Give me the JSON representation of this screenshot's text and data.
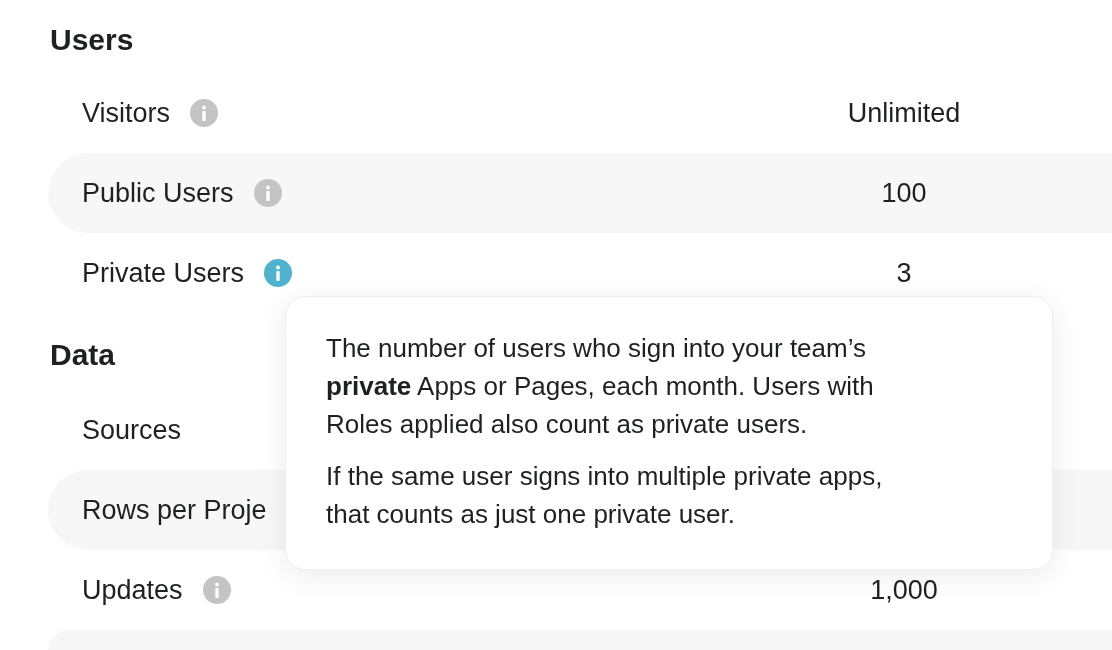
{
  "sections": [
    {
      "title": "Users",
      "rows": [
        {
          "label": "Visitors",
          "info_icon": true,
          "active": false,
          "value": "Unlimited"
        },
        {
          "label": "Public Users",
          "info_icon": true,
          "active": false,
          "value": "100"
        },
        {
          "label": "Private Users",
          "info_icon": true,
          "active": true,
          "value": "3"
        }
      ]
    },
    {
      "title": "Data",
      "rows": [
        {
          "label": "Sources",
          "info_icon": false
        },
        {
          "label": "Rows per Proje",
          "info_icon": false
        },
        {
          "label": "Updates",
          "info_icon": true,
          "active": false,
          "value": "1,000"
        }
      ]
    }
  ],
  "tooltip": {
    "paragraphs": [
      "The number of users who sign into your team’s **private** Apps or Pages, each month. Users with Roles applied also count as private users.",
      "If the same user signs into multiple private apps, that counts as just one private user."
    ]
  }
}
